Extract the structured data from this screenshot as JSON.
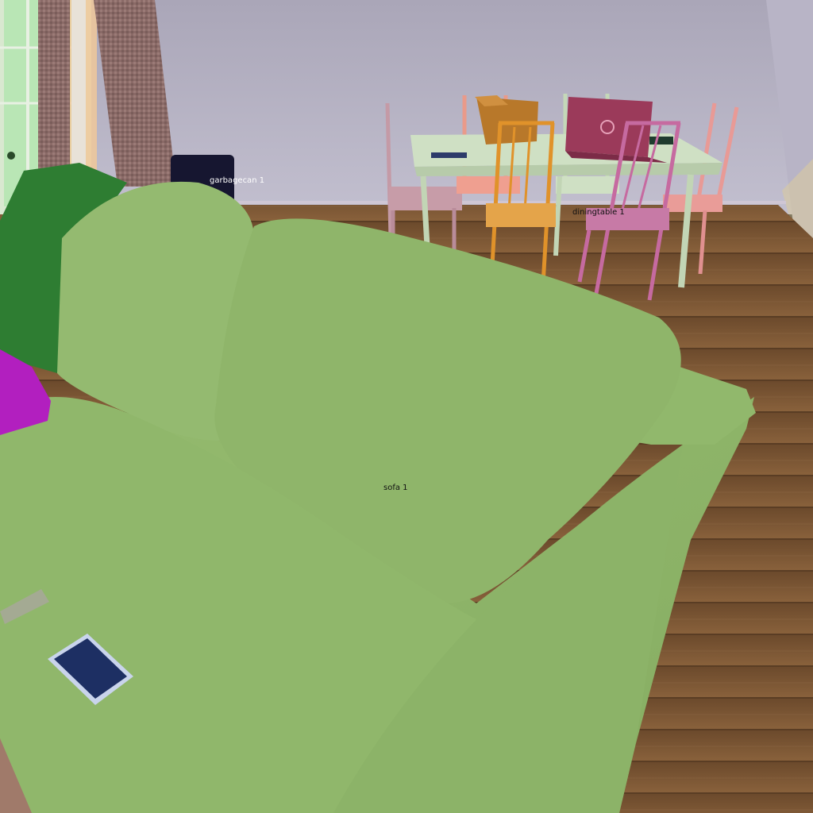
{
  "scene": {
    "view": "3D indoor living room render with semantic segmentation overlay",
    "objects": [
      {
        "id": "sofa",
        "label": "sofa 1",
        "color": "#8fb56a"
      },
      {
        "id": "garbagecan",
        "label": "garbagecan 1",
        "color": "#161630"
      },
      {
        "id": "diningtable",
        "label": "diningtable 1",
        "color": "#cfe0c4"
      }
    ],
    "colors": {
      "wall": "#b9b5c8",
      "floor": "#7a5634",
      "sofa": "#8fb56a",
      "sofa_dark_green_object": "#2e7d32",
      "magenta_object": "#b21fbf",
      "laptop": "#9b3a5a",
      "tablet": "#1d2f63"
    }
  }
}
